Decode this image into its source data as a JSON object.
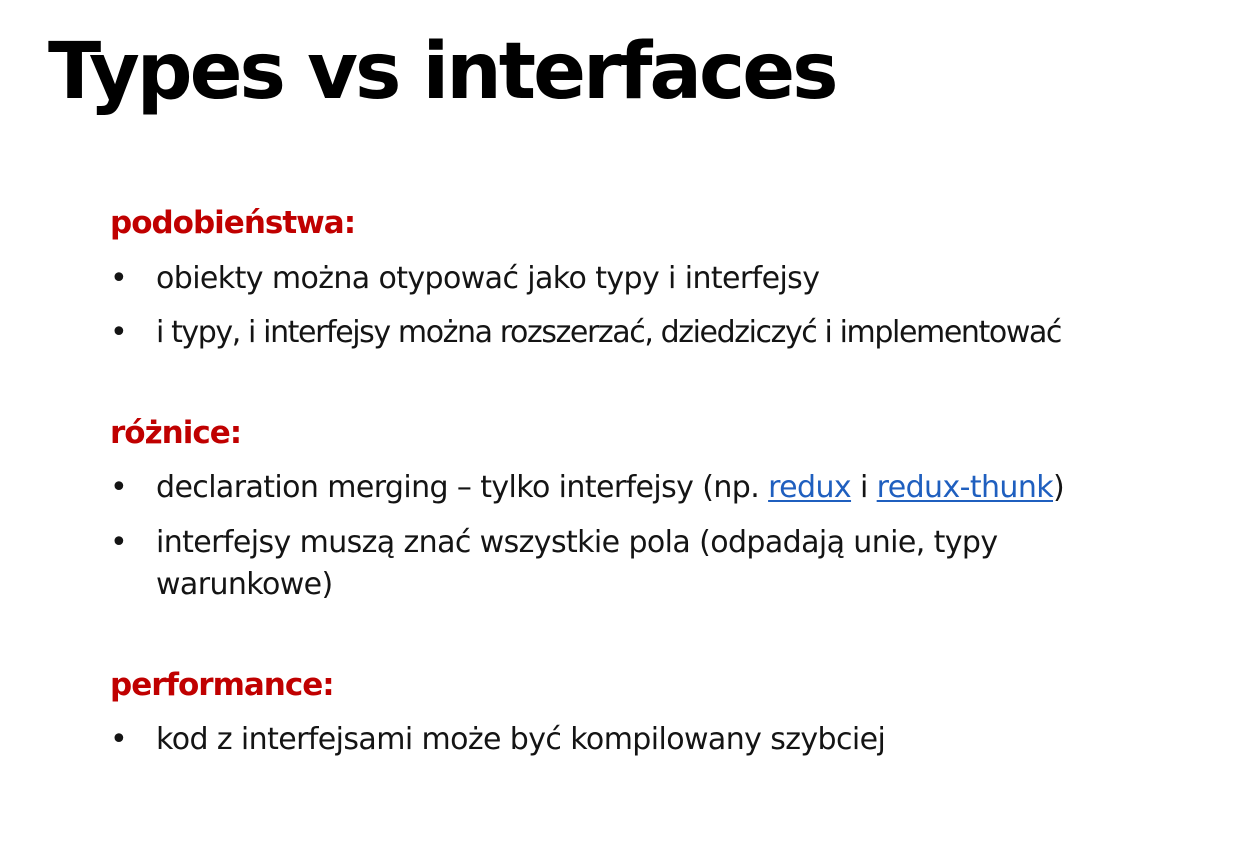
{
  "title": "Types vs interfaces",
  "bullet_glyph": "•",
  "colors": {
    "heading": "#c00000",
    "link": "#1f5fbf",
    "text": "#141414"
  },
  "sections": [
    {
      "heading": "podobieństwa:",
      "items": [
        "obiekty można otypować jako typy i interfejsy",
        "i typy, i interfejsy można rozszerzać, dziedziczyć i implementować"
      ]
    },
    {
      "heading": "różnice:",
      "items": [
        {
          "before": "declaration merging – tylko interfejsy (np. ",
          "link1": "redux",
          "between": " i ",
          "link2": "redux-thunk",
          "after": ")"
        },
        "interfejsy muszą znać wszystkie pola (odpadają unie, typy warunkowe)"
      ]
    },
    {
      "heading": "performance:",
      "items": [
        "kod z interfejsami może być kompilowany szybciej"
      ]
    }
  ]
}
